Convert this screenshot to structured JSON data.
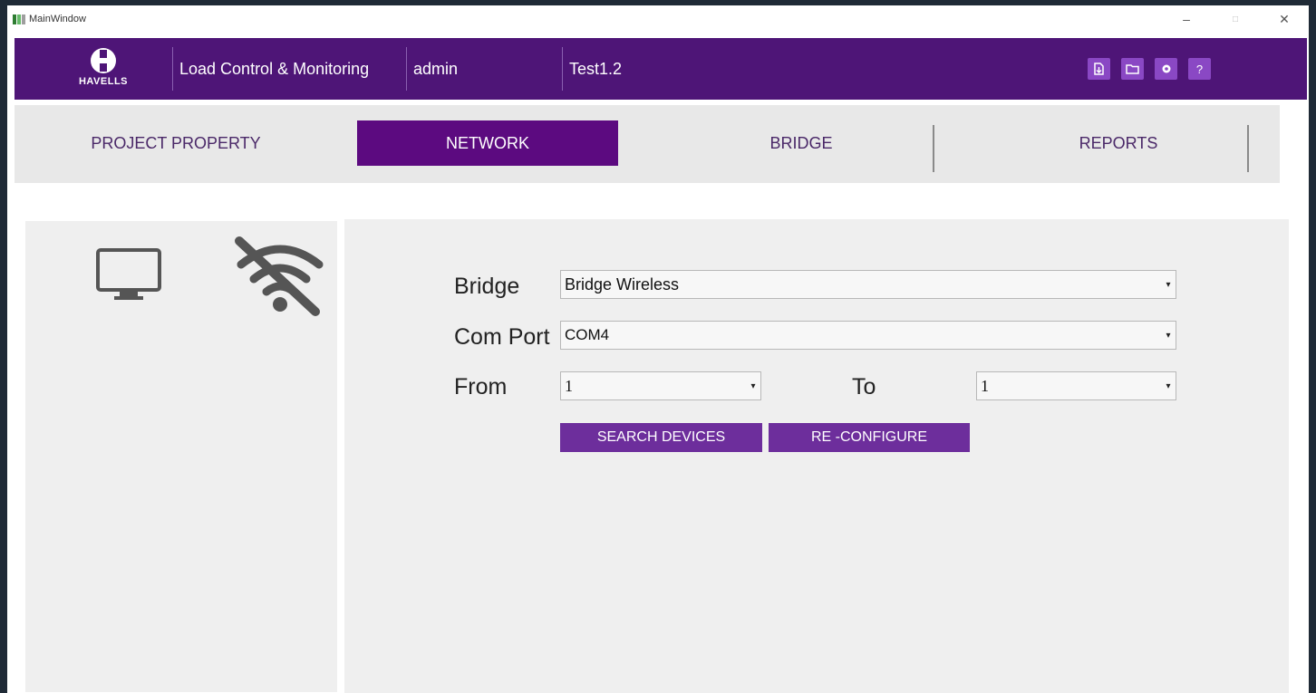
{
  "window": {
    "title": "MainWindow"
  },
  "header": {
    "logo_text": "HAVELLS",
    "app_name": "Load Control & Monitoring",
    "user": "admin",
    "project": "Test1.2",
    "icons": [
      "export-icon",
      "folder-icon",
      "settings-icon",
      "help-icon"
    ],
    "help_glyph": "?"
  },
  "tabs": [
    {
      "label": "PROJECT PROPERTY",
      "active": false
    },
    {
      "label": "NETWORK",
      "active": true
    },
    {
      "label": "BRIDGE",
      "active": false
    },
    {
      "label": "REPORTS",
      "active": false
    }
  ],
  "form": {
    "bridge_label": "Bridge",
    "bridge_value": "Bridge Wireless",
    "comport_label": "Com Port",
    "comport_value": "COM4",
    "from_label": "From",
    "from_value": "1",
    "to_label": "To",
    "to_value": "1",
    "search_button": "SEARCH DEVICES",
    "reconfigure_button": "RE -CONFIGURE"
  },
  "colors": {
    "header_bg": "#4e1577",
    "tab_active_bg": "#5c0a80",
    "button_bg": "#6d2e9c",
    "header_icon_bg": "#8a48c4",
    "panel_bg": "#efefef"
  }
}
